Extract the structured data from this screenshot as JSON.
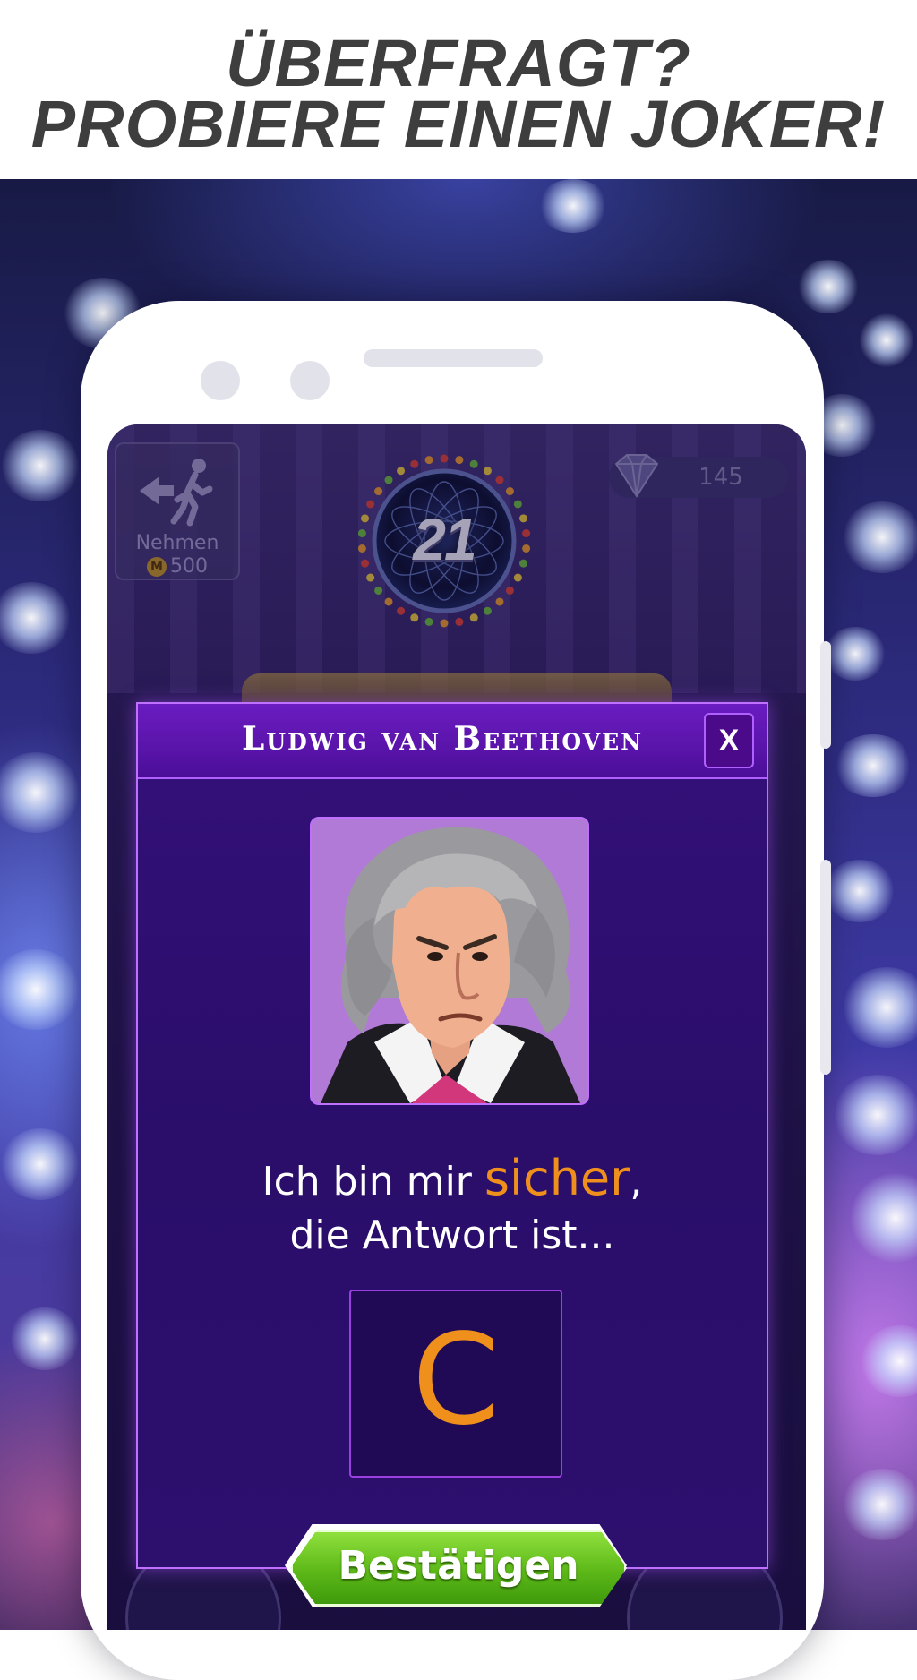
{
  "promo": {
    "line1": "ÜBERFRAGT?",
    "line2": "PROBIERE EINEN JOKER!"
  },
  "game": {
    "exit_label": "Nehmen",
    "exit_cost": "500",
    "coin_symbol": "M",
    "gem_count": "145",
    "question_number": "21"
  },
  "modal": {
    "title": "Ludwig van Beethoven",
    "close_label": "X",
    "speech_part1": "Ich bin mir ",
    "speech_highlight": "sicher",
    "speech_part2": ",",
    "speech_line2": "die Antwort ist...",
    "answer": "C",
    "confirm_label": "Bestätigen"
  },
  "colors": {
    "accent_orange": "#f0901c",
    "modal_purple": "#34107a",
    "confirm_green": "#5cb818"
  },
  "icons": [
    "exit-walk-icon",
    "coin-icon",
    "diamond-icon",
    "close-icon",
    "beethoven-portrait"
  ]
}
